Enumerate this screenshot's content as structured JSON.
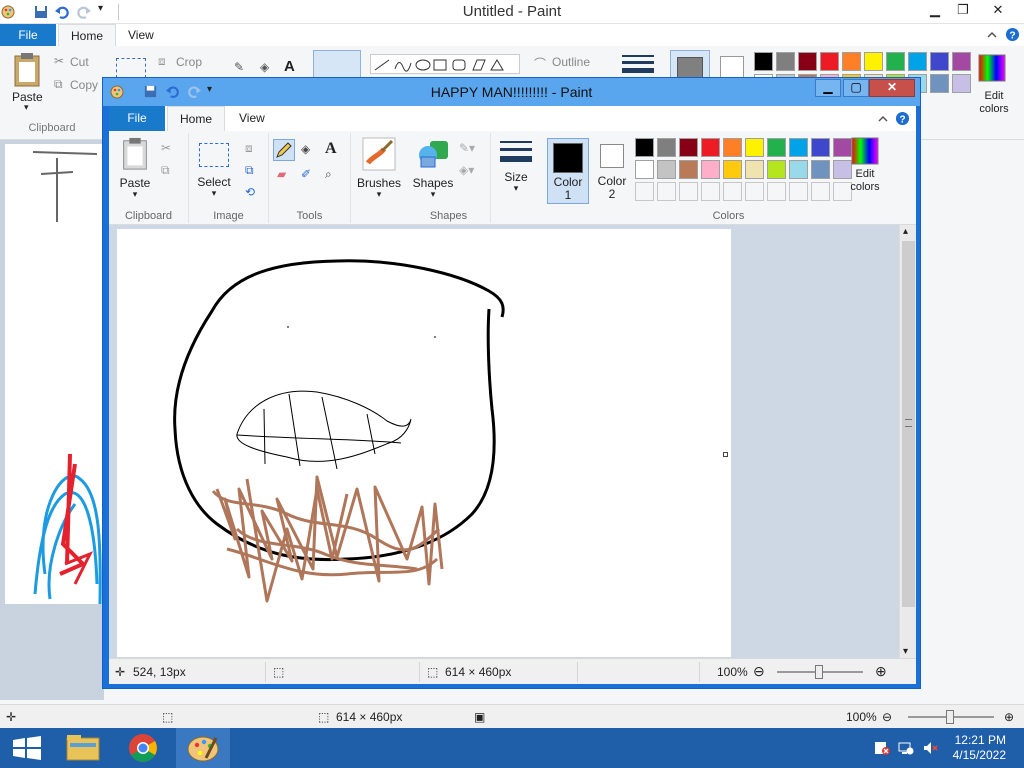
{
  "background_window": {
    "title": "Untitled - Paint",
    "tabs": {
      "file": "File",
      "home": "Home",
      "view": "View"
    },
    "ribbon": {
      "paste": "Paste",
      "cut": "Cut",
      "copy": "Copy",
      "crop": "Crop",
      "clipboard_group": "Clipboard",
      "outline": "Outline",
      "edit_colors": "Edit colors"
    },
    "status": {
      "size": "614 × 460px",
      "zoom": "100%"
    }
  },
  "window": {
    "title": "HAPPY MAN!!!!!!!!! - Paint",
    "tabs": {
      "file": "File",
      "home": "Home",
      "view": "View"
    },
    "ribbon": {
      "clipboard": {
        "paste": "Paste",
        "label": "Clipboard"
      },
      "image": {
        "select": "Select",
        "label": "Image"
      },
      "tools": {
        "label": "Tools"
      },
      "brushes": {
        "label": "Brushes"
      },
      "shapes": {
        "shapes": "Shapes",
        "label": "Shapes"
      },
      "size": {
        "label": "Size"
      },
      "colors": {
        "color1": "Color",
        "color1_num": "1",
        "color2": "Color",
        "color2_num": "2",
        "edit_colors": "Edit",
        "edit_colors2": "colors",
        "label": "Colors",
        "color1_value": "#000000",
        "color2_value": "#ffffff",
        "palette_row1": [
          "#000000",
          "#7f7f7f",
          "#880015",
          "#ed1c24",
          "#ff7f27",
          "#fff200",
          "#22b14c",
          "#00a2e8",
          "#3f48cc",
          "#a349a4"
        ],
        "palette_row2": [
          "#ffffff",
          "#c3c3c3",
          "#b97a57",
          "#ffaec9",
          "#ffc90e",
          "#efe4b0",
          "#b5e61d",
          "#99d9ea",
          "#7092be",
          "#c8bfe7"
        ]
      }
    },
    "status": {
      "cursor_pos": "524, 13px",
      "selection_size": "",
      "image_size": "614 × 460px",
      "zoom": "100%"
    }
  },
  "taskbar": {
    "time": "12:21 PM",
    "date": "4/15/2022"
  },
  "colors": {
    "accent": "#1979ca",
    "taskbar": "#1f5ea8",
    "beard": "#b0765a",
    "face_outline": "#000000"
  }
}
